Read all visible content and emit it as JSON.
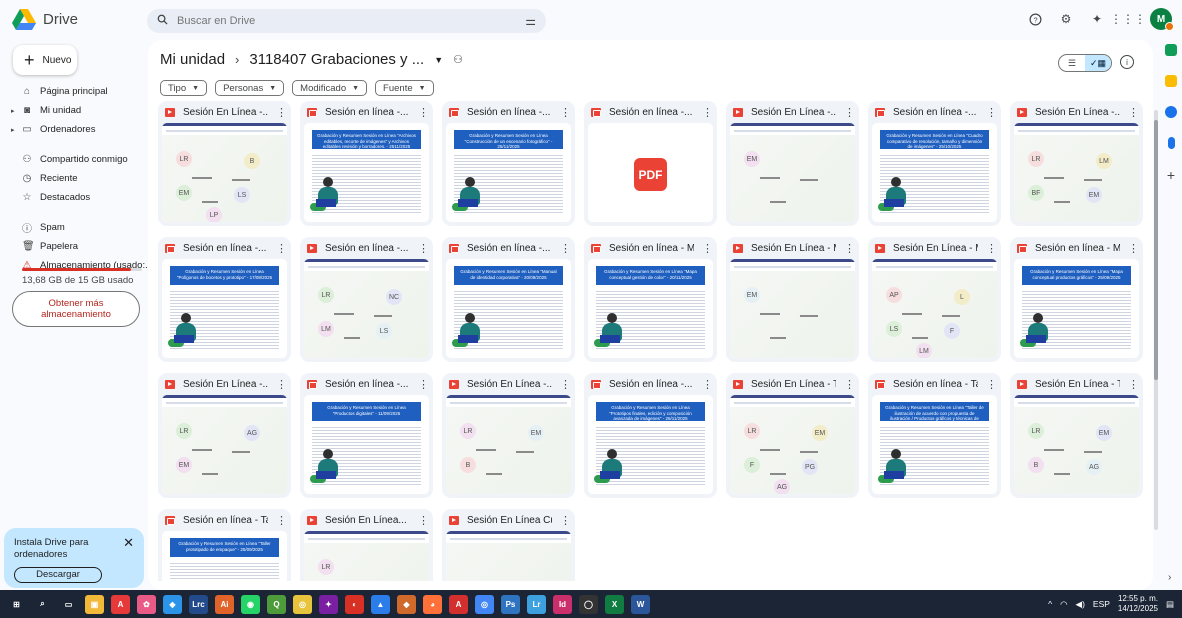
{
  "app": {
    "name": "Drive"
  },
  "search": {
    "placeholder": "Buscar en Drive"
  },
  "header": {
    "avatar_initials": "M"
  },
  "sidebar": {
    "new_label": "Nuevo",
    "items": [
      {
        "label": "Página principal",
        "icon": "home-icon"
      },
      {
        "label": "Mi unidad",
        "icon": "my-drive-icon"
      },
      {
        "label": "Ordenadores",
        "icon": "computers-icon"
      },
      {
        "label": "Compartido conmigo",
        "icon": "shared-icon"
      },
      {
        "label": "Reciente",
        "icon": "clock-icon"
      },
      {
        "label": "Destacados",
        "icon": "star-icon"
      },
      {
        "label": "Spam",
        "icon": "spam-icon"
      },
      {
        "label": "Papelera",
        "icon": "trash-icon"
      },
      {
        "label": "Almacenamiento (usado:...",
        "icon": "warning-icon"
      }
    ],
    "storage_text": "13,68 GB de 15 GB usado",
    "storage_used_fraction": 0.912,
    "more_storage_label": "Obtener más almacenamiento",
    "promo": {
      "text": "Instala Drive para ordenadores",
      "button": "Descargar"
    }
  },
  "main": {
    "breadcrumb": {
      "root": "Mi unidad",
      "folder": "3118407 Grabaciones y ..."
    },
    "chips": [
      "Tipo",
      "Personas",
      "Modificado",
      "Fuente"
    ],
    "files": [
      {
        "title": "Sesión En Línea -...",
        "kind": "video",
        "thumb": "meet",
        "initials": [
          "LR",
          "B",
          "EM",
          "LS",
          "LP"
        ]
      },
      {
        "title": "Sesión en línea -...",
        "kind": "pdf",
        "thumb": "doc",
        "heading": "Grabación y Resumen Sesión en Línea \"Archivos editables, recorte de imágenes\" y Archivos editables revisión y borradores. - 2511/2025"
      },
      {
        "title": "Sesión en línea -...",
        "kind": "pdf",
        "thumb": "doc",
        "heading": "Grabación y Resumen Sesión en Línea \"Construcción de un escenario fotográfico\" - 25/11/2025"
      },
      {
        "title": "Sesión en línea -...",
        "kind": "pdf",
        "thumb": "pdf",
        "pdf_label": "PDF"
      },
      {
        "title": "Sesión En Línea -...",
        "kind": "video",
        "thumb": "meet",
        "initials": [
          "EM"
        ]
      },
      {
        "title": "Sesión en línea -...",
        "kind": "pdf",
        "thumb": "doc",
        "heading": "Grabación y Resumen Sesión en Línea \"Cuadro comparativo de resolución, tamaño y dimensión de imágenes\" - 25/10/2025"
      },
      {
        "title": "Sesión En Línea -...",
        "kind": "video",
        "thumb": "meet",
        "initials": [
          "LR",
          "LM",
          "BF",
          "EM"
        ]
      },
      {
        "title": "Sesión en línea -...",
        "kind": "pdf",
        "thumb": "doc",
        "heading": "Grabación y Resumen Sesión en Línea \"Polígonos de bocetos y prototipo\" - 17/08/2025"
      },
      {
        "title": "Sesión en línea -...",
        "kind": "video",
        "thumb": "meet",
        "initials": [
          "LR",
          "NC",
          "LM",
          "LS"
        ]
      },
      {
        "title": "Sesión en línea -...",
        "kind": "pdf",
        "thumb": "doc",
        "heading": "Grabación y Resumen Sesión en Línea \"Manual de identidad corporativa\" - 20/09/2025"
      },
      {
        "title": "Sesión en línea - Map...",
        "kind": "pdf",
        "thumb": "doc",
        "heading": "Grabación y Resumen Sesión en Línea \"Mapa conceptual gestión de color\" - 20/11/2025"
      },
      {
        "title": "Sesión En Línea - Ma...",
        "kind": "video",
        "thumb": "meet",
        "initials": [
          "EM"
        ]
      },
      {
        "title": "Sesión En Línea - Map...",
        "kind": "video",
        "thumb": "meet",
        "initials": [
          "AP",
          "L",
          "LS",
          "F",
          "LM"
        ]
      },
      {
        "title": "Sesión en línea - Map...",
        "kind": "pdf",
        "thumb": "doc",
        "heading": "Grabación y Resumen Sesión en Línea \"Mapa conceptual productos gráficos\" - 25/09/2025"
      },
      {
        "title": "Sesión En Línea -...",
        "kind": "video",
        "thumb": "meet",
        "initials": [
          "LR",
          "AG",
          "EM"
        ]
      },
      {
        "title": "Sesión en línea -...",
        "kind": "pdf",
        "thumb": "doc",
        "heading": "Grabación y Resumen Sesión en Línea \"Productos digitales\" - 11/09/2025"
      },
      {
        "title": "Sesión En Línea -...",
        "kind": "video",
        "thumb": "meet",
        "initials": [
          "LR",
          "EM",
          "B"
        ]
      },
      {
        "title": "Sesión en línea -...",
        "kind": "pdf",
        "thumb": "doc",
        "heading": "Grabación y Resumen Sesión en Línea \"Prototipos finales, edición y composición avanzada de imágenes\" - 26/11/2025"
      },
      {
        "title": "Sesión En Línea - Tall...",
        "kind": "video",
        "thumb": "meet",
        "initials": [
          "LR",
          "EM",
          "F",
          "PG",
          "AG"
        ]
      },
      {
        "title": "Sesión en línea - Talle...",
        "kind": "pdf",
        "thumb": "doc",
        "heading": "Grabación y Resumen Sesión en Línea \"Taller de ilustración de acuerdo con propuesta de ilustración / Productos gráficos y técnicas de ilustración\" - 26/11/2025"
      },
      {
        "title": "Sesión En Línea - Tall...",
        "kind": "video",
        "thumb": "meet",
        "initials": [
          "LR",
          "EM",
          "B",
          "AG"
        ]
      },
      {
        "title": "Sesión en línea - Talle...",
        "kind": "pdf",
        "thumb": "doc",
        "heading": "Grabación y Resumen Sesión en Línea \"Taller prototipado de empaque\" - 25/09/2025"
      },
      {
        "title": "Sesión En Línea...",
        "kind": "video",
        "thumb": "meet",
        "initials": [
          "LR"
        ]
      },
      {
        "title": "Sesión En Línea Cuad...",
        "kind": "video",
        "thumb": "meet",
        "initials": []
      }
    ]
  },
  "taskbar": {
    "apps": [
      "start",
      "search",
      "task-view",
      "files",
      "acrobat",
      "gallery",
      "vscode",
      "lightroom-classic",
      "illustrator",
      "whatsapp",
      "qgis",
      "chrome",
      "app",
      "app",
      "photos",
      "app",
      "firefox",
      "acrobat",
      "chrome",
      "photoshop",
      "lightroom",
      "indesign",
      "github",
      "excel",
      "word"
    ],
    "lang": "ESP",
    "time": "12:55 p. m.",
    "date": "14/12/2025"
  }
}
